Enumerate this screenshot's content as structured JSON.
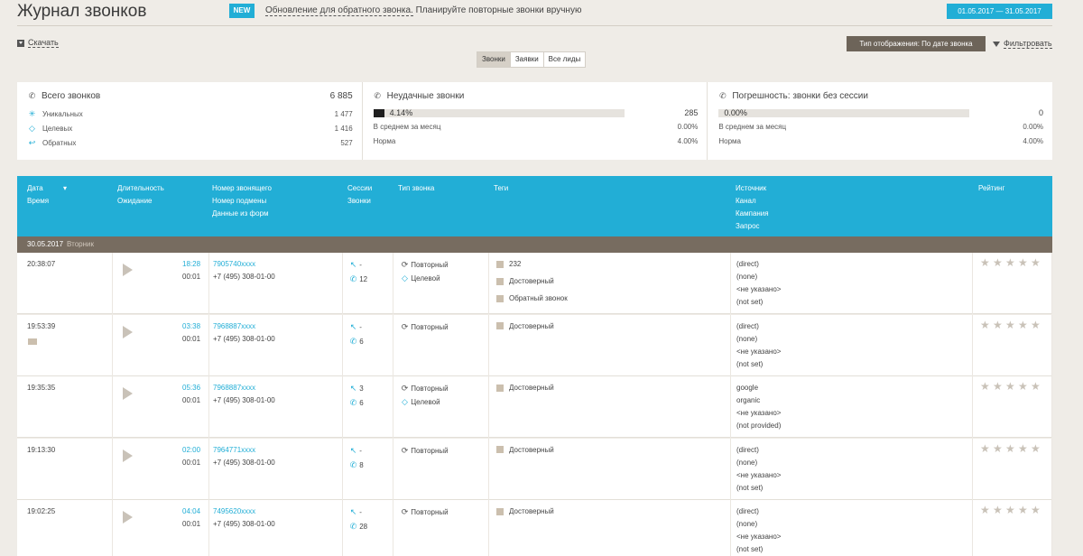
{
  "header": {
    "title": "Журнал звонков",
    "new_badge": "NEW",
    "notice_link": "Обновление для обратного звонка.",
    "notice_text": " Планируйте повторные звонки вручную",
    "date_range": "01.05.2017  —  31.05.2017"
  },
  "toolbar": {
    "download": "Скачать",
    "view_mode": "Тип отображения: По дате звонка",
    "filter": "Фильтровать"
  },
  "tabs": [
    "Звонки",
    "Заявки",
    "Все лиды"
  ],
  "stats": {
    "total": {
      "title": "Всего звонков",
      "value": "6 885",
      "rows": [
        {
          "label": "Уникальных",
          "value": "1 477"
        },
        {
          "label": "Целевых",
          "value": "1 416"
        },
        {
          "label": "Обратных",
          "value": "527"
        }
      ]
    },
    "failed": {
      "title": "Неудачные звонки",
      "bar_label": "4.14%",
      "bar_fraction": 0.0414,
      "value": "285",
      "rows": [
        {
          "label": "В среднем за месяц",
          "value": "0.00%"
        },
        {
          "label": "Норма",
          "value": "4.00%"
        }
      ]
    },
    "error": {
      "title": "Погрешность: звонки без сессии",
      "bar_label": "0.00%",
      "bar_fraction": 0,
      "value": "0",
      "rows": [
        {
          "label": "В среднем за месяц",
          "value": "0.00%"
        },
        {
          "label": "Норма",
          "value": "4.00%"
        }
      ]
    }
  },
  "table": {
    "headers": {
      "date": "Дата",
      "time": "Время",
      "duration": "Длительность",
      "wait": "Ожидание",
      "caller": "Номер звонящего",
      "sub": "Номер подмены",
      "form": "Данные из форм",
      "sessions": "Сессии",
      "calls": "Звонки",
      "type": "Тип звонка",
      "tags": "Теги",
      "source": "Источник",
      "channel": "Канал",
      "campaign": "Кампания",
      "query": "Запрос",
      "rating": "Рейтинг"
    },
    "day": {
      "date": "30.05.2017",
      "weekday": "Вторник"
    },
    "rows": [
      {
        "time": "20:38:07",
        "duration": "18:28",
        "wait": "00:01",
        "caller": "7905740xxxx",
        "sub": "+7 (495) 308-01-00",
        "sessions": "-",
        "calls": "12",
        "types": [
          "Повторный",
          "Целевой"
        ],
        "tags": [
          "232",
          "Достоверный",
          "Обратный звонок"
        ],
        "source": [
          "(direct)",
          "(none)",
          "<не указано>",
          "(not set)"
        ],
        "folder": false
      },
      {
        "time": "19:53:39",
        "duration": "03:38",
        "wait": "00:01",
        "caller": "7968887xxxx",
        "sub": "+7 (495) 308-01-00",
        "sessions": "-",
        "calls": "6",
        "types": [
          "Повторный"
        ],
        "tags": [
          "Достоверный"
        ],
        "source": [
          "(direct)",
          "(none)",
          "<не указано>",
          "(not set)"
        ],
        "folder": true
      },
      {
        "time": "19:35:35",
        "duration": "05:36",
        "wait": "00:01",
        "caller": "7968887xxxx",
        "sub": "+7 (495) 308-01-00",
        "sessions": "3",
        "calls": "6",
        "types": [
          "Повторный",
          "Целевой"
        ],
        "tags": [
          "Достоверный"
        ],
        "source": [
          "google",
          "organic",
          "<не указано>",
          "(not provided)"
        ],
        "folder": false
      },
      {
        "time": "19:13:30",
        "duration": "02:00",
        "wait": "00:01",
        "caller": "7964771xxxx",
        "sub": "+7 (495) 308-01-00",
        "sessions": "-",
        "calls": "8",
        "types": [
          "Повторный"
        ],
        "tags": [
          "Достоверный"
        ],
        "source": [
          "(direct)",
          "(none)",
          "<не указано>",
          "(not set)"
        ],
        "folder": false
      },
      {
        "time": "19:02:25",
        "duration": "04:04",
        "wait": "00:01",
        "caller": "7495620xxxx",
        "sub": "+7 (495) 308-01-00",
        "sessions": "-",
        "calls": "28",
        "types": [
          "Повторный"
        ],
        "tags": [
          "Достоверный"
        ],
        "source": [
          "(direct)",
          "(none)",
          "<не указано>",
          "(not set)"
        ],
        "folder": false
      }
    ]
  },
  "colors": {
    "accent": "#22aed6",
    "daybar": "#776c60",
    "viewmode": "#6d6459"
  }
}
